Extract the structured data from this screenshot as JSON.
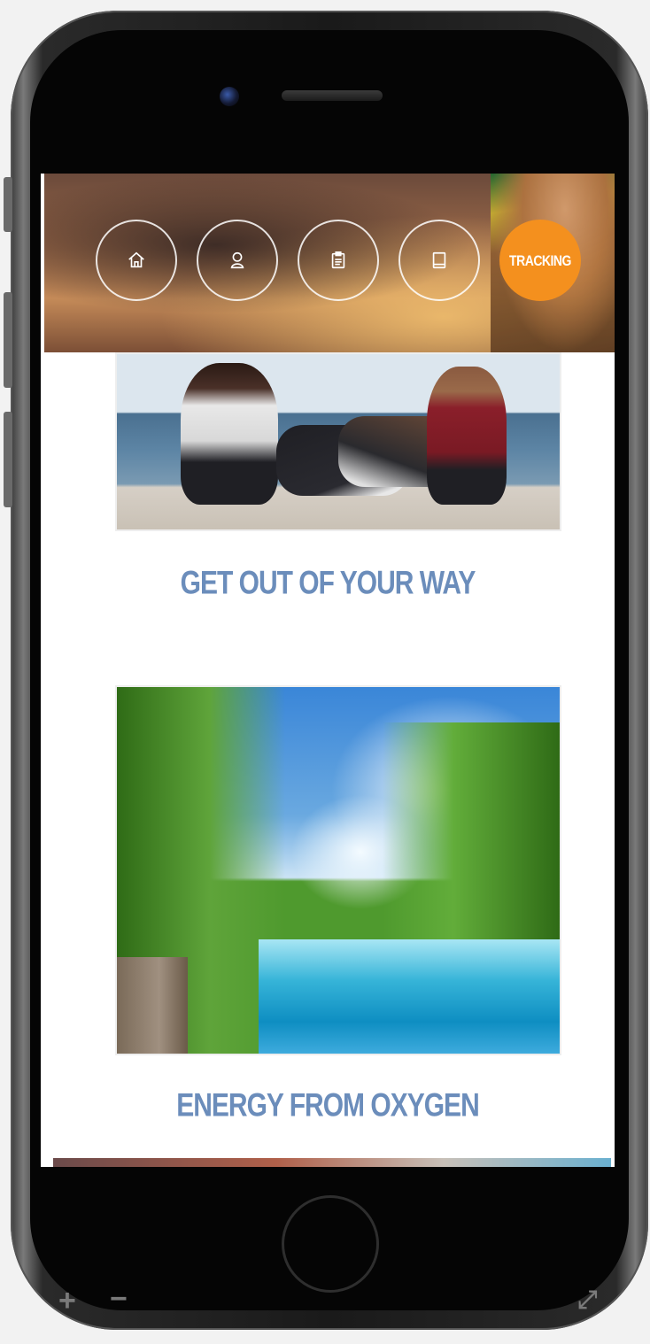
{
  "nav": {
    "items": [
      {
        "icon": "home-icon"
      },
      {
        "icon": "user-icon"
      },
      {
        "icon": "clipboard-icon"
      },
      {
        "icon": "book-icon"
      },
      {
        "label": "TRACKING",
        "active": true
      }
    ],
    "accent_color": "#f4901e"
  },
  "cards": [
    {
      "title": "GET OUT OF YOUR WAY"
    },
    {
      "title": "ENERGY FROM OXYGEN"
    }
  ],
  "colors": {
    "title": "#6b8dbb",
    "screen_bg": "#ffffff"
  }
}
